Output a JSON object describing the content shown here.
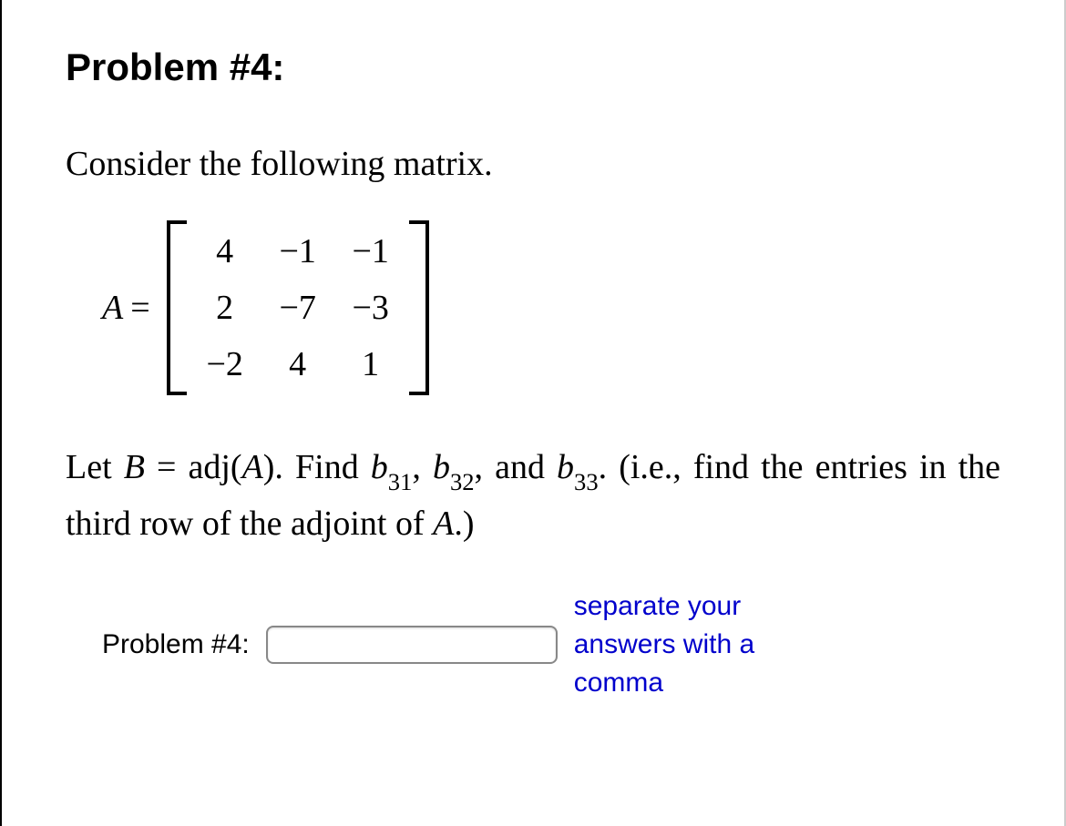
{
  "title": "Problem #4:",
  "intro": "Consider the following matrix.",
  "matrix_label": "A",
  "equals": "=",
  "matrix": {
    "r1c1": "4",
    "r1c2": "−1",
    "r1c3": "−1",
    "r2c1": "2",
    "r2c2": "−7",
    "r2c3": "−3",
    "r3c1": "−2",
    "r3c2": "4",
    "r3c3": "1"
  },
  "question": {
    "pre": "Let ",
    "B": "B",
    "eq_adj": " = adj(",
    "A": "A",
    "post_adj": "). Find ",
    "b": "b",
    "s31": "31",
    "c1": ", ",
    "s32": "32",
    "c2": ", and ",
    "s33": "33",
    "post_find": ". (i.e., find the entries in the third row of the adjoint of ",
    "A2": "A",
    "end": ".)"
  },
  "answer_label": "Problem #4:",
  "hint": "separate your answers with a comma"
}
